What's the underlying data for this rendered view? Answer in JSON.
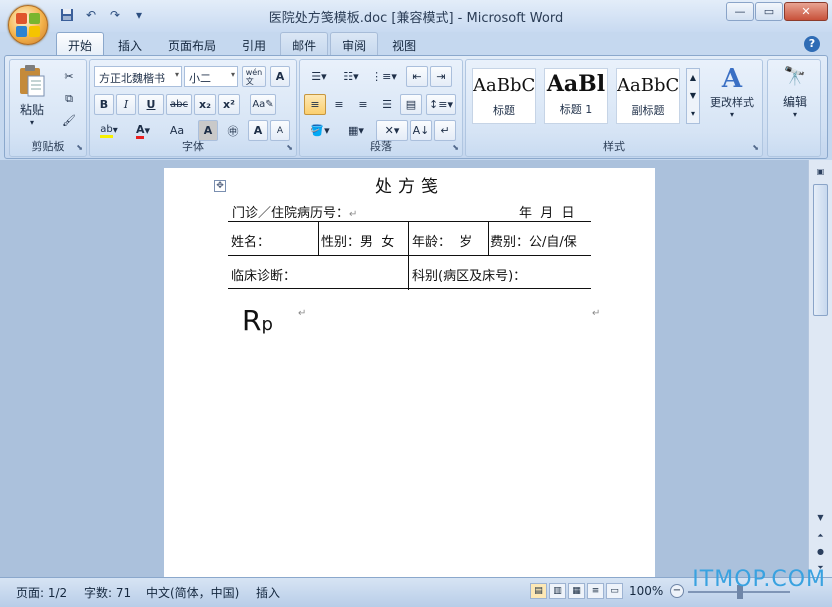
{
  "window": {
    "title": "医院处方笺模板.doc [兼容模式] - Microsoft Word",
    "controls": {
      "minimize": "—",
      "restore": "▭",
      "close": "✕"
    }
  },
  "quick_access": {
    "save_icon": "save-icon",
    "undo_icon": "undo-icon",
    "redo_icon": "redo-icon",
    "more": "▾"
  },
  "tabs": [
    {
      "label": "开始",
      "state": "active"
    },
    {
      "label": "插入"
    },
    {
      "label": "页面布局"
    },
    {
      "label": "引用"
    },
    {
      "label": "邮件"
    },
    {
      "label": "审阅"
    },
    {
      "label": "视图"
    }
  ],
  "ribbon": {
    "clipboard": {
      "paste_label": "粘贴",
      "group_label": "剪贴板"
    },
    "font": {
      "font_name": "方正北魏楷书",
      "font_size": "小二",
      "wen_label": "wén\n文",
      "bold": "B",
      "italic": "I",
      "underline": "U",
      "strike": "abc",
      "subscript": "x₂",
      "superscript": "x²",
      "char_scale": "Aa",
      "grow": "A",
      "shrink": "A",
      "group_label": "字体"
    },
    "paragraph": {
      "group_label": "段落"
    },
    "styles": {
      "items": [
        {
          "preview": "AaBbC",
          "name": "标题"
        },
        {
          "preview": "AaBl",
          "name": "标题 1"
        },
        {
          "preview": "AaBbC",
          "name": "副标题"
        }
      ],
      "change_styles": "更改样式",
      "group_label": "样式"
    },
    "editing": {
      "label": "编辑"
    }
  },
  "document": {
    "title": "处方笺",
    "line1_left": "门诊／住院病历号：",
    "line1_right": "年  月  日",
    "table": {
      "row1": [
        "姓名：",
        "性别：男  女",
        "年龄：  岁",
        "费别：公/自/保"
      ],
      "row2": [
        "临床诊断：",
        "科别(病区及床号)："
      ]
    },
    "rp_big": "R",
    "rp_small": "p",
    "para_mark": "↵"
  },
  "statusbar": {
    "page": "页面: 1/2",
    "words": "字数: 71",
    "language": "中文(简体，中国)",
    "mode": "插入",
    "zoom": "100%"
  },
  "watermark": "ITMOP.COM",
  "colors": {
    "accent": "#2f6cb5",
    "ribbon": "#d6e4f5",
    "docbg": "#abc1dc"
  }
}
